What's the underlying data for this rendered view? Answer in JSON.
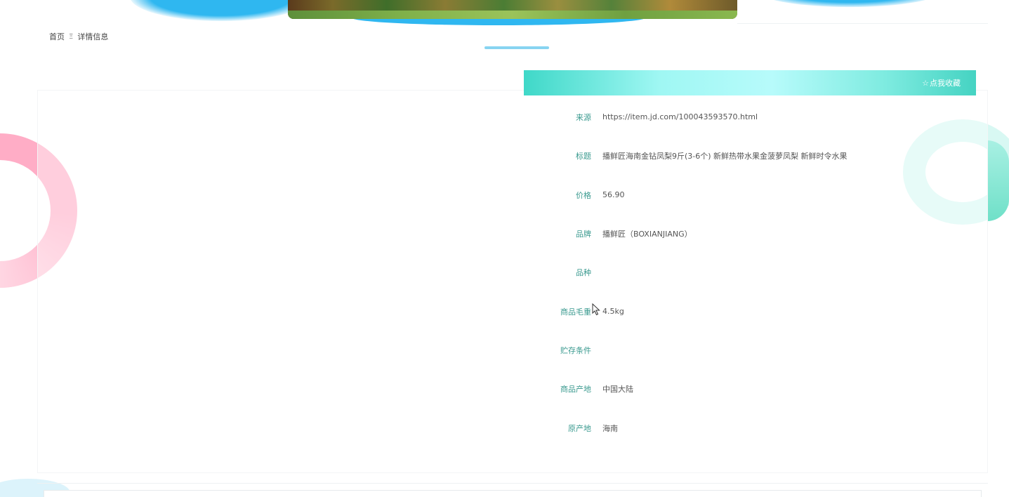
{
  "breadcrumb": {
    "home": "首页",
    "separator": "Ξ",
    "current": "详情信息"
  },
  "favorite": {
    "icon": "☆",
    "label": "点我收藏"
  },
  "details": [
    {
      "label": "来源",
      "value": "https://item.jd.com/100043593570.html"
    },
    {
      "label": "标题",
      "value": "播鲜匠海南金钻凤梨9斤(3-6个) 新鲜热带水果金菠萝凤梨 新鲜时令水果"
    },
    {
      "label": "价格",
      "value": "56.90"
    },
    {
      "label": "品牌",
      "value": "播鲜匠（BOXIANJIANG）"
    },
    {
      "label": "品种",
      "value": ""
    },
    {
      "label": "商品毛重",
      "value": "4.5kg"
    },
    {
      "label": "贮存条件",
      "value": ""
    },
    {
      "label": "商品产地",
      "value": "中国大陆"
    },
    {
      "label": "原产地",
      "value": "海南"
    }
  ],
  "colors": {
    "label": "#3a9a8f",
    "accent": "#45d3c2",
    "banner_blue": "#2fb7f0"
  }
}
